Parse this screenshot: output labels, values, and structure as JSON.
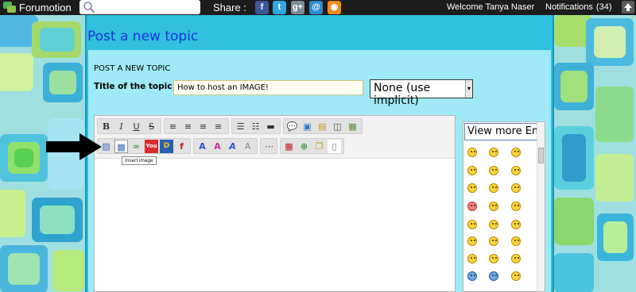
{
  "topbar": {
    "brand": "Forumotion",
    "share_label": "Share :",
    "social_icons": [
      "facebook-icon",
      "twitter-icon",
      "google-plus-icon",
      "email-icon",
      "rss-icon"
    ],
    "welcome": "Welcome Tanya Naser",
    "notifications_label": "Notifications",
    "notifications_count": "(34)"
  },
  "panel": {
    "title": "Post a new topic",
    "heading": "POST A NEW TOPIC",
    "title_label": "Title of the topic",
    "title_value": "How to host an IMAGE!",
    "select_value": "None (use implicit)"
  },
  "editor": {
    "tooltip": "Insert image",
    "toolbar_row1": [
      "bold-icon",
      "italic-icon",
      "underline-icon",
      "strikethrough-icon",
      "align-left-icon",
      "align-center-icon",
      "align-right-icon",
      "justify-icon",
      "bullet-list-icon",
      "numbered-list-icon",
      "horizontal-rule-icon",
      "quote-icon",
      "code-icon",
      "spoiler-icon",
      "hide-icon",
      "table-icon"
    ],
    "toolbar_row2": [
      "insert-image-icon",
      "host-image-icon",
      "link-icon",
      "youtube-icon",
      "dailymotion-icon",
      "flash-icon",
      "font-size-icon",
      "color-icon",
      "font-icon",
      "remove-format-icon",
      "line-icon",
      "date-icon",
      "more-icon",
      "copy-icon",
      "source-icon"
    ]
  },
  "smileys": {
    "header": "View more Emoticons"
  },
  "colors": {
    "topbar": "#1c1c1c",
    "panel": "#2fc1df",
    "content": "#9feaf6",
    "title": "#1a35d8"
  }
}
